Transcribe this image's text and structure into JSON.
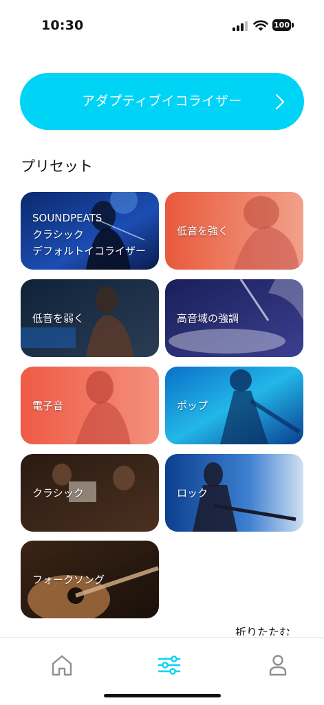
{
  "status": {
    "time": "10:30",
    "battery": "100",
    "icons": [
      "signal-icon",
      "wifi-icon",
      "battery-icon"
    ]
  },
  "adaptive_eq": {
    "label": "アダプティブイコライザー",
    "icon": "chevron-right-icon"
  },
  "presets_title": "プリセット",
  "presets": [
    {
      "line1": "SOUNDPEATS",
      "line2": "クラシック",
      "line3": "デフォルトイコライザー"
    },
    {
      "label": "低音を強く"
    },
    {
      "label": "低音を弱く"
    },
    {
      "label": "高音域の強調"
    },
    {
      "label": "電子音"
    },
    {
      "label": "ポップ"
    },
    {
      "label": "クラシック"
    },
    {
      "label": "ロック"
    },
    {
      "label": "フォークソング"
    }
  ],
  "collapse_label": "折りたたむ",
  "tab_bar": {
    "tabs": [
      {
        "icon": "home-icon",
        "active": false
      },
      {
        "icon": "equalizer-icon",
        "active": true
      },
      {
        "icon": "profile-icon",
        "active": false
      }
    ],
    "active_color": "#00d4f6",
    "inactive_color": "#8e8e93"
  },
  "accent_color": "#00d4f6"
}
